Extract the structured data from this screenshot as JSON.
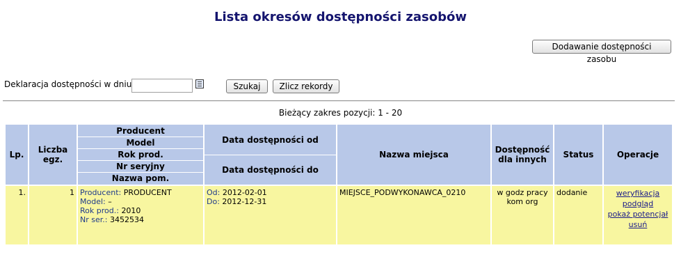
{
  "page": {
    "title": "Lista okresów dostępności zasobów"
  },
  "toolbar": {
    "add_label": "Dodawanie dostępności zasobu"
  },
  "filter": {
    "date_label": "Deklaracja dostępności w dniu:",
    "date_value": "",
    "search_label": "Szukaj",
    "count_label": "Zlicz rekordy",
    "calendar_icon": "calendar-icon"
  },
  "range": {
    "text": "Bieżący zakres pozycji: 1 - 20"
  },
  "table": {
    "headers": {
      "lp": "Lp.",
      "count": "Liczba egz.",
      "producer": "Producent",
      "model": "Model",
      "year": "Rok prod.",
      "serial": "Nr seryjny",
      "room": "Nazwa pom.",
      "date_from": "Data dostępności od",
      "date_to": "Data dostępności do",
      "place": "Nazwa miejsca",
      "availability": "Dostępność dla innych",
      "status": "Status",
      "ops": "Operacje"
    },
    "rows": [
      {
        "lp": "1.",
        "count": "1",
        "producer_label": "Producent:",
        "producer": "PRODUCENT",
        "model_label": "Model:",
        "model": "–",
        "year_label": "Rok prod.:",
        "year": "2010",
        "serial_label": "Nr ser.:",
        "serial": "3452534",
        "from_label": "Od:",
        "from": "2012-02-01",
        "to_label": "Do:",
        "to": "2012-12-31",
        "place": "MIEJSCE_PODWYKONAWCA_0210",
        "availability": "w godz pracy kom org",
        "status": "dodanie",
        "ops": [
          "weryfikacja",
          "podgląd",
          "pokaż potencjał",
          "usuń"
        ]
      }
    ]
  }
}
